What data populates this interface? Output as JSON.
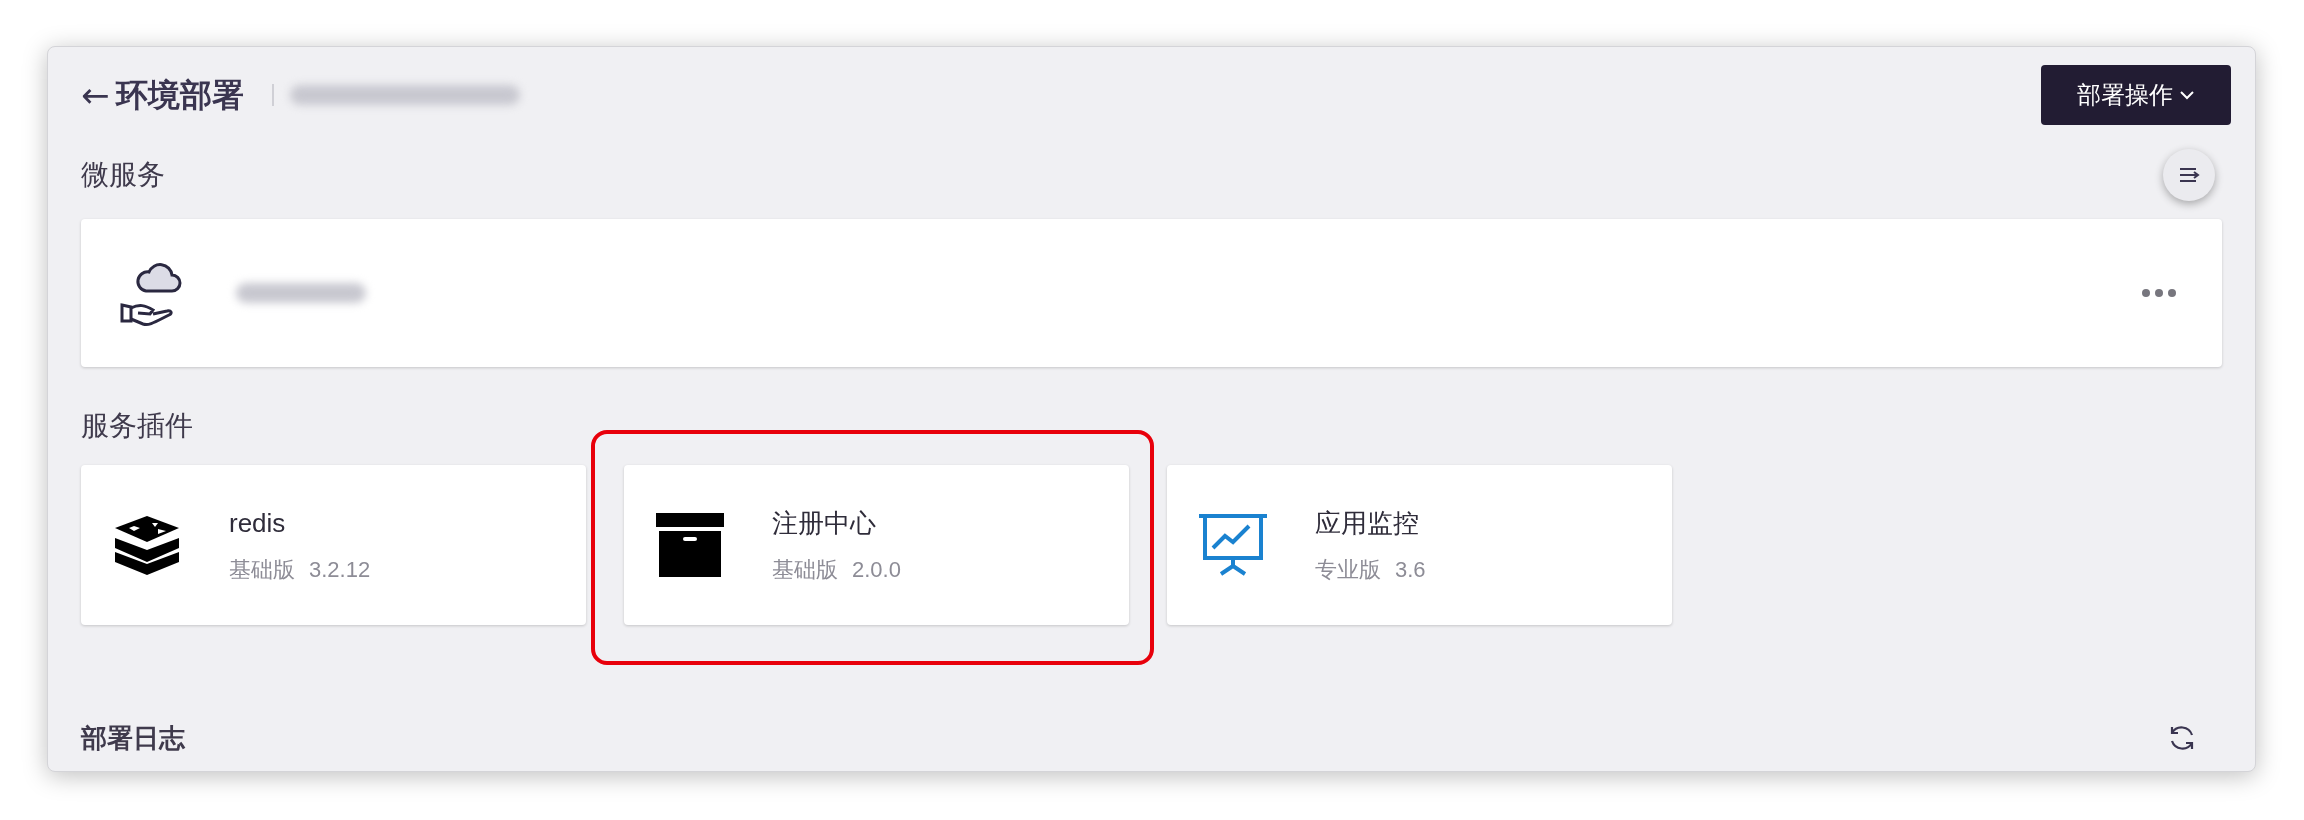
{
  "header": {
    "back_icon": "←",
    "title": "环境部署",
    "action_button": "部署操作"
  },
  "microservices": {
    "title": "微服务"
  },
  "plugins": {
    "title": "服务插件",
    "items": [
      {
        "kind": "redis",
        "name": "redis",
        "edition": "基础版",
        "version": "3.2.12",
        "highlighted": false
      },
      {
        "kind": "archive",
        "name": "注册中心",
        "edition": "基础版",
        "version": "2.0.0",
        "highlighted": true
      },
      {
        "kind": "monitor",
        "name": "应用监控",
        "edition": "专业版",
        "version": "3.6",
        "highlighted": false
      }
    ]
  },
  "logs": {
    "title": "部署日志"
  }
}
